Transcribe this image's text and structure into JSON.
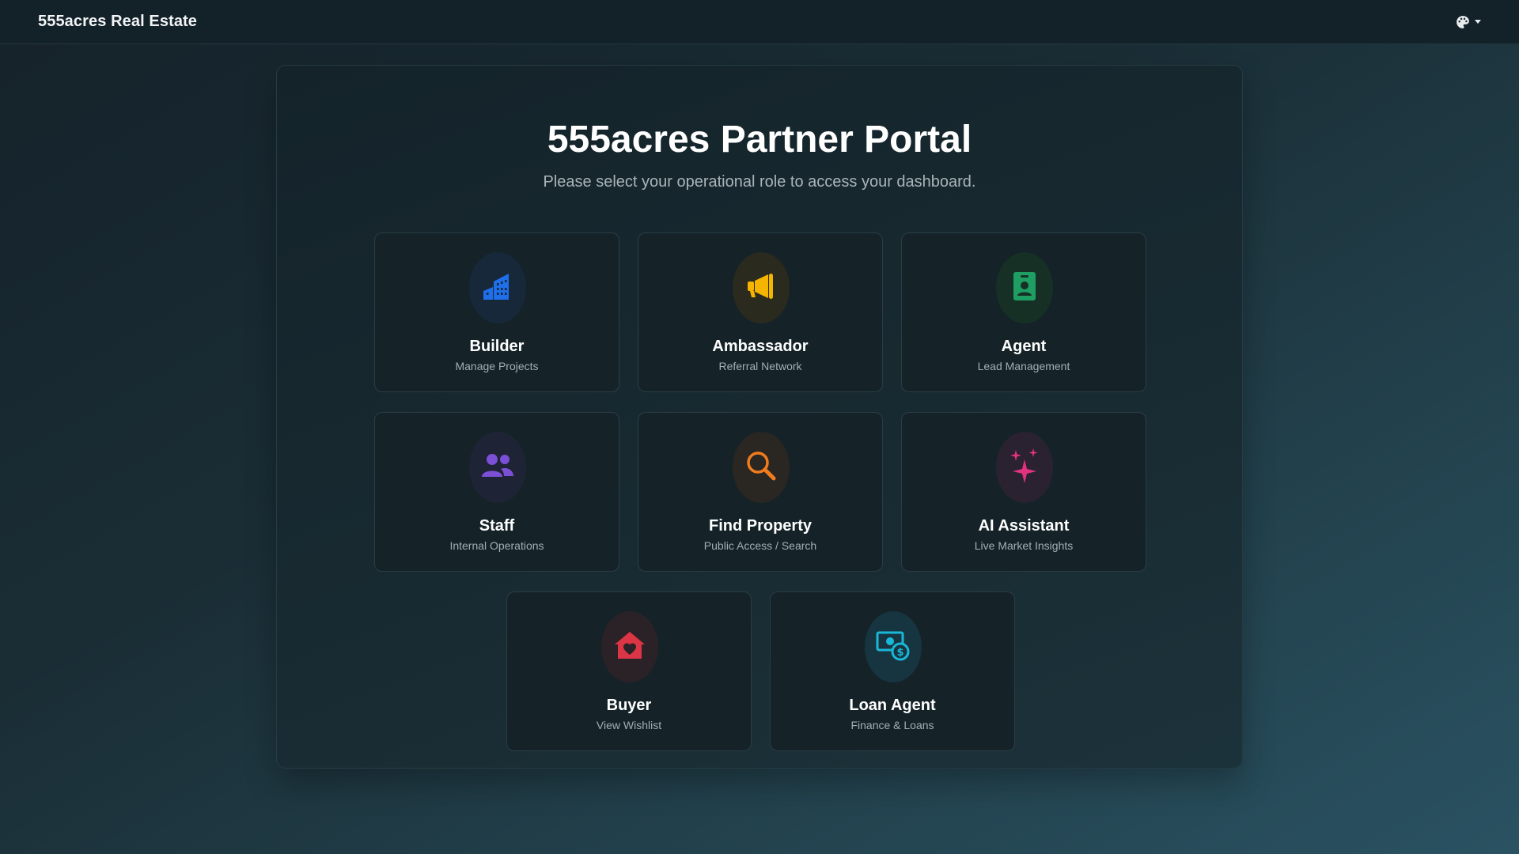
{
  "navbar": {
    "brand": "555acres Real Estate",
    "theme_icon": "palette-icon"
  },
  "portal": {
    "title": "555acres Partner Portal",
    "subtitle": "Please select your operational role to access your dashboard."
  },
  "roles": [
    {
      "title": "Builder",
      "subtitle": "Manage Projects",
      "icon": "building-icon",
      "color": "#1f6feb",
      "bg": "#16283a"
    },
    {
      "title": "Ambassador",
      "subtitle": "Referral Network",
      "icon": "megaphone-icon",
      "color": "#f5b400",
      "bg": "#2a2a1f"
    },
    {
      "title": "Agent",
      "subtitle": "Lead Management",
      "icon": "id-badge-icon",
      "color": "#1e9e63",
      "bg": "#163026"
    },
    {
      "title": "Staff",
      "subtitle": "Internal Operations",
      "icon": "users-icon",
      "color": "#7b4fd6",
      "bg": "#1f2336"
    },
    {
      "title": "Find Property",
      "subtitle": "Public Access / Search",
      "icon": "search-icon",
      "color": "#f07c1e",
      "bg": "#2a2622"
    },
    {
      "title": "AI Assistant",
      "subtitle": "Live Market Insights",
      "icon": "sparkles-icon",
      "color": "#e0327e",
      "bg": "#2a2230"
    },
    {
      "title": "Buyer",
      "subtitle": "View Wishlist",
      "icon": "house-heart-icon",
      "color": "#dc3545",
      "bg": "#2b2228"
    },
    {
      "title": "Loan Agent",
      "subtitle": "Finance & Loans",
      "icon": "money-exchange-icon",
      "color": "#1ab8d8",
      "bg": "#163540"
    }
  ]
}
